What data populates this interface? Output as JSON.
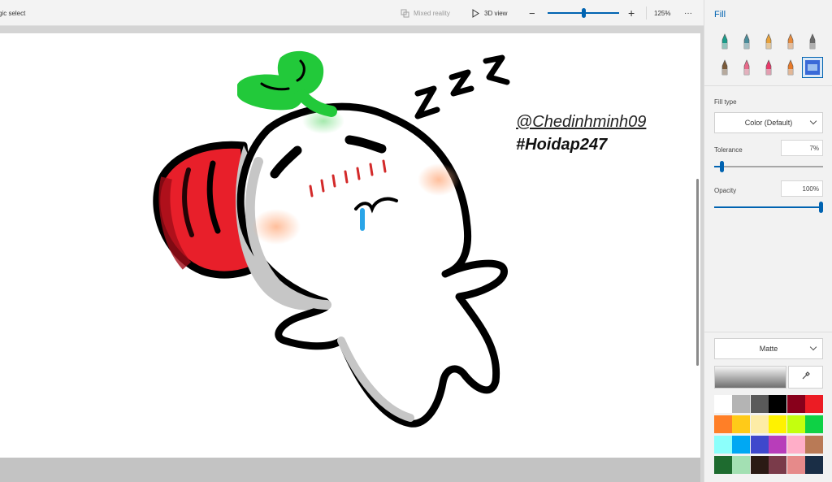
{
  "toolbar": {
    "magic_select": "gic select",
    "mixed_reality": "Mixed reality",
    "view_3d": "3D view",
    "zoom_minus": "−",
    "zoom_plus": "+",
    "zoom_level": "125%",
    "more": "···",
    "zoom_fraction": 0.5
  },
  "canvas": {
    "handle": "@Chedinhminh09",
    "hashtag": "#Hoidap247",
    "sleep_z": "Z"
  },
  "panel": {
    "title": "Fill",
    "fill_type_label": "Fill type",
    "fill_type_value": "Color (Default)",
    "tolerance_label": "Tolerance",
    "tolerance_value": "7%",
    "tolerance_fraction": 0.07,
    "opacity_label": "Opacity",
    "opacity_value": "100%",
    "opacity_fraction": 1.0,
    "finish_value": "Matte",
    "brushes": [
      {
        "name": "calligraphy-pen",
        "color": "#1a9c8a"
      },
      {
        "name": "pen",
        "color": "#4a8c9a"
      },
      {
        "name": "oil-brush",
        "color": "#e8a23b"
      },
      {
        "name": "watercolor",
        "color": "#e88a3b"
      },
      {
        "name": "pixel-pen",
        "color": "#6a6a6a"
      },
      {
        "name": "pencil",
        "color": "#7a5a3a"
      },
      {
        "name": "eraser",
        "color": "#e86a8a"
      },
      {
        "name": "crayon",
        "color": "#e83a6a"
      },
      {
        "name": "spray-can",
        "color": "#e87a2a"
      },
      {
        "name": "fill-bucket",
        "color": "#2a5ac8"
      }
    ],
    "palette": [
      "#ffffff",
      "#b4b4b4",
      "#5a5a5a",
      "#000000",
      "#88001b",
      "#ec1c24",
      "#ff7f27",
      "#ffca18",
      "#fdeca6",
      "#fff200",
      "#c4ff0e",
      "#0ed145",
      "#8cfffb",
      "#00a8f3",
      "#3f48cc",
      "#b83dba",
      "#ffaec8",
      "#b97a56",
      "#1e6b2f",
      "#a3e0b3",
      "#2b1a14",
      "#7a3b4a",
      "#e68a8a",
      "#1a2e46"
    ]
  }
}
